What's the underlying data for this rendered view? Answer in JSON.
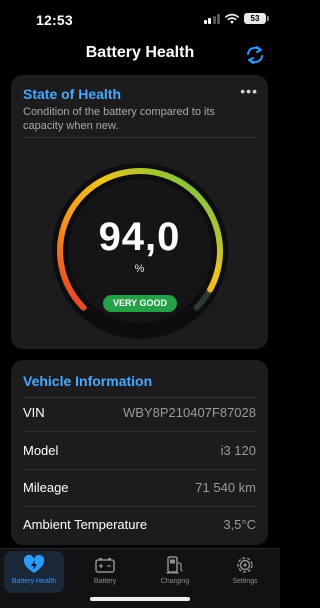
{
  "status_bar": {
    "time": "12:53",
    "battery_level": "53"
  },
  "header": {
    "title": "Battery Health",
    "refresh_icon": "refresh-icon"
  },
  "state_of_health": {
    "title": "State of Health",
    "description": "Condition of the battery compared to its capacity when new.",
    "value": "94,0",
    "value_number": 94.0,
    "unit": "%",
    "rating": "VERY GOOD",
    "more_icon": "ellipsis-icon",
    "colors": {
      "low": "#e8362a",
      "mid": "#f2c21b",
      "high": "#4cc54e",
      "badge": "#24a148"
    }
  },
  "vehicle_info": {
    "title": "Vehicle Information",
    "rows": [
      {
        "label": "VIN",
        "value": "WBY8P210407F87028"
      },
      {
        "label": "Model",
        "value": "i3 120"
      },
      {
        "label": "Mileage",
        "value": "71 540 km"
      },
      {
        "label": "Ambient Temperature",
        "value": "3,5°C"
      }
    ]
  },
  "tabbar": {
    "tabs": [
      {
        "label": "Battery Health",
        "icon": "heart-bolt-icon",
        "active": true
      },
      {
        "label": "Battery",
        "icon": "battery-icon",
        "active": false
      },
      {
        "label": "Charging",
        "icon": "charging-station-icon",
        "active": false
      },
      {
        "label": "Settings",
        "icon": "gear-icon",
        "active": false
      }
    ],
    "accent": "#2b9bff"
  }
}
